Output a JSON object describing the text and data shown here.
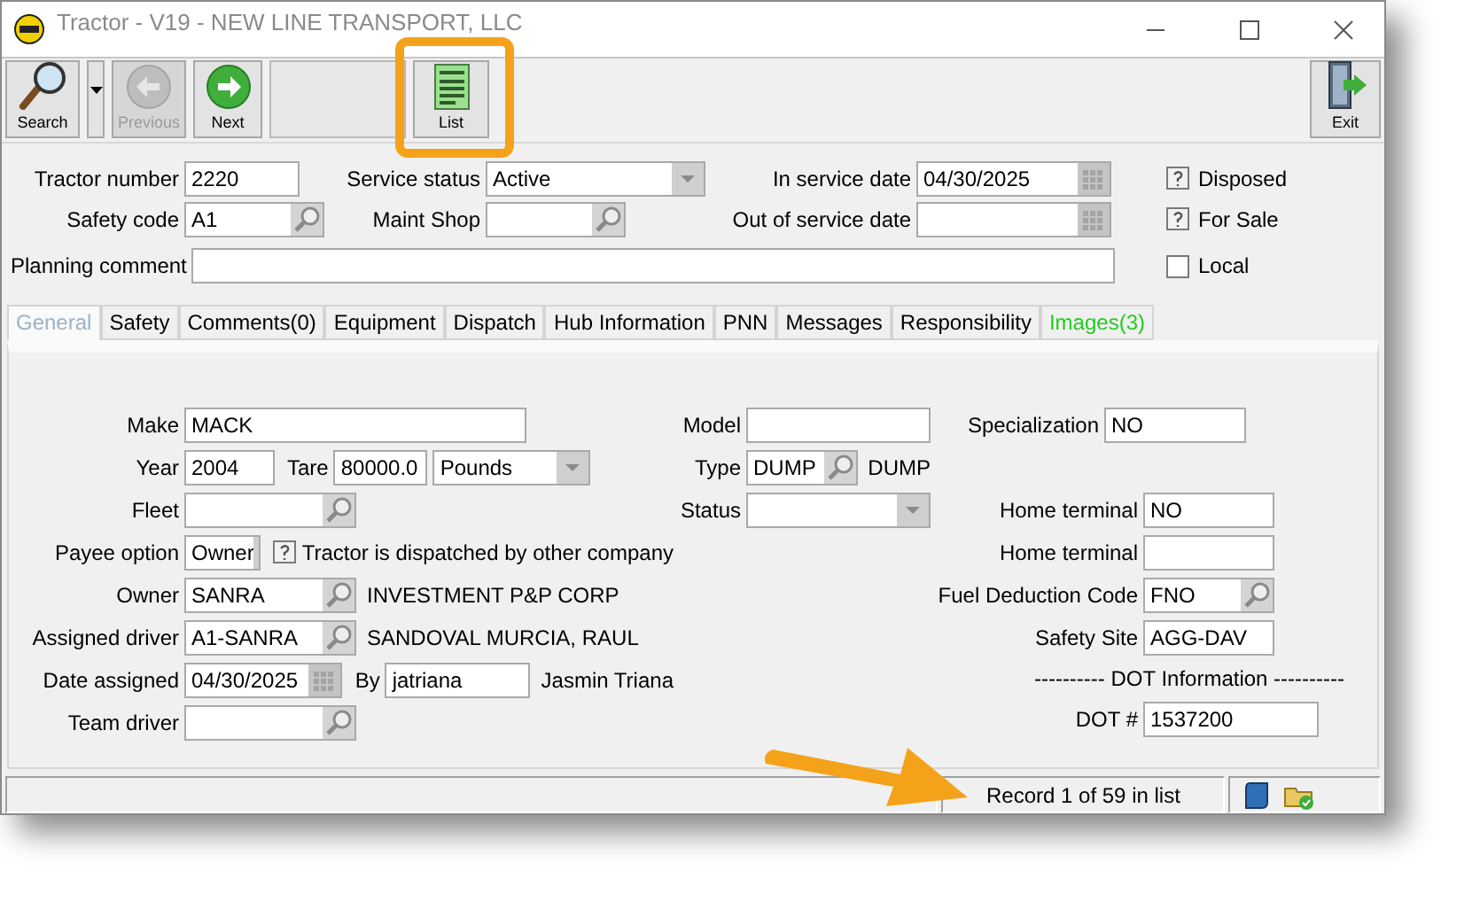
{
  "window": {
    "title": "Tractor - V19 - NEW LINE TRANSPORT, LLC"
  },
  "toolbar": {
    "buttons": [
      {
        "kind": "search",
        "label": "Search",
        "disabled": false,
        "highlighted": false
      },
      {
        "kind": "menu",
        "disabled": false,
        "highlighted": false
      },
      {
        "kind": "previous",
        "label": "Previous",
        "disabled": true,
        "highlighted": false
      },
      {
        "kind": "next",
        "label": "Next",
        "disabled": false,
        "highlighted": false
      },
      {
        "kind": "list",
        "label": "List",
        "disabled": false,
        "highlighted": true
      },
      {
        "kind": "exit",
        "label": "Exit",
        "disabled": false,
        "highlighted": false
      }
    ]
  },
  "header": {
    "fields": [
      {
        "label": "Tractor number",
        "kind": "text",
        "value": "2220"
      },
      {
        "label": "Service status",
        "kind": "dropdown",
        "value": "Active"
      },
      {
        "label": "In service date",
        "kind": "date",
        "value": "04/30/2025"
      },
      {
        "label": "Safety code",
        "kind": "lookup",
        "value": "A1"
      },
      {
        "label": "Maint Shop",
        "kind": "lookup"
      },
      {
        "label": "Out of service date",
        "kind": "date"
      }
    ],
    "planning_comment": {
      "label": "Planning comment"
    },
    "flags": [
      {
        "label": "Disposed",
        "checked": false,
        "indeterminate": true
      },
      {
        "label": "For Sale",
        "checked": false,
        "indeterminate": true
      },
      {
        "label": "Local",
        "checked": false,
        "indeterminate": false
      }
    ]
  },
  "tabs": [
    {
      "label": "General",
      "selected": true,
      "color": "#9db2c6"
    },
    {
      "label": "Safety",
      "selected": false,
      "color": "#000000"
    },
    {
      "label": "Comments(0)",
      "selected": false,
      "color": "#000000"
    },
    {
      "label": "Equipment",
      "selected": false,
      "color": "#000000"
    },
    {
      "label": "Dispatch",
      "selected": false,
      "color": "#000000"
    },
    {
      "label": "Hub Information",
      "selected": false,
      "color": "#000000"
    },
    {
      "label": "PNN",
      "selected": false,
      "color": "#000000"
    },
    {
      "label": "Messages",
      "selected": false,
      "color": "#000000"
    },
    {
      "label": "Responsibility",
      "selected": false,
      "color": "#000000"
    },
    {
      "label": "Images(3)",
      "selected": false,
      "color": "#22cc22"
    }
  ],
  "general": {
    "left": [
      {
        "label": "Make",
        "items": [
          {
            "kind": "text",
            "value": "MACK"
          }
        ]
      },
      {
        "label": "Year",
        "items": [
          {
            "kind": "text",
            "value": "2004"
          },
          {
            "kind": "label",
            "text": "Tare"
          },
          {
            "kind": "text",
            "value": "80000.0"
          },
          {
            "kind": "dropdown",
            "value": "Pounds"
          }
        ]
      },
      {
        "label": "Fleet",
        "items": [
          {
            "kind": "lookup"
          }
        ]
      },
      {
        "label": "Payee option",
        "items": [
          {
            "kind": "dropdown",
            "value": "Owner"
          },
          {
            "kind": "checkbox",
            "checked": false,
            "indeterminate": true,
            "text": "Tractor is dispatched by other company"
          }
        ]
      },
      {
        "label": "Owner",
        "items": [
          {
            "kind": "lookup",
            "value": "SANRA"
          },
          {
            "kind": "note",
            "text": "INVESTMENT P&P CORP"
          }
        ]
      },
      {
        "label": "Assigned driver",
        "items": [
          {
            "kind": "lookup",
            "value": "A1-SANRA"
          },
          {
            "kind": "note",
            "text": "SANDOVAL MURCIA, RAUL"
          }
        ]
      },
      {
        "label": "Date assigned",
        "items": [
          {
            "kind": "date",
            "value": "04/30/2025"
          },
          {
            "kind": "label",
            "text": "By"
          },
          {
            "kind": "text",
            "value": "jatriana"
          },
          {
            "kind": "note",
            "text": "Jasmin Triana"
          }
        ]
      },
      {
        "label": "Team driver",
        "items": [
          {
            "kind": "lookup"
          }
        ]
      }
    ],
    "middle": [
      {
        "label": "Model",
        "items": [
          {
            "kind": "text"
          }
        ]
      },
      {
        "label": "Type",
        "items": [
          {
            "kind": "lookup",
            "value": "DUMP"
          },
          {
            "kind": "note",
            "text": "DUMP"
          }
        ]
      },
      {
        "label": "Status",
        "items": [
          {
            "kind": "dropdown"
          }
        ]
      }
    ],
    "right": [
      {
        "label": "Specialization",
        "items": [
          {
            "kind": "text",
            "value": "NO"
          }
        ]
      },
      {
        "label": "Home terminal",
        "items": [
          {
            "kind": "text",
            "value": "NO"
          }
        ]
      },
      {
        "label": "Home terminal",
        "items": [
          {
            "kind": "text"
          }
        ]
      },
      {
        "label": "Fuel Deduction Code",
        "items": [
          {
            "kind": "lookup",
            "value": "FNO"
          }
        ]
      },
      {
        "label": "Safety Site",
        "items": [
          {
            "kind": "text",
            "value": "AGG-DAV"
          }
        ]
      }
    ],
    "dot": {
      "heading": "---------- DOT Information ----------",
      "label": "DOT #",
      "value": "1537200"
    }
  },
  "status_bar": {
    "text": "Record 1 of 59 in list"
  }
}
